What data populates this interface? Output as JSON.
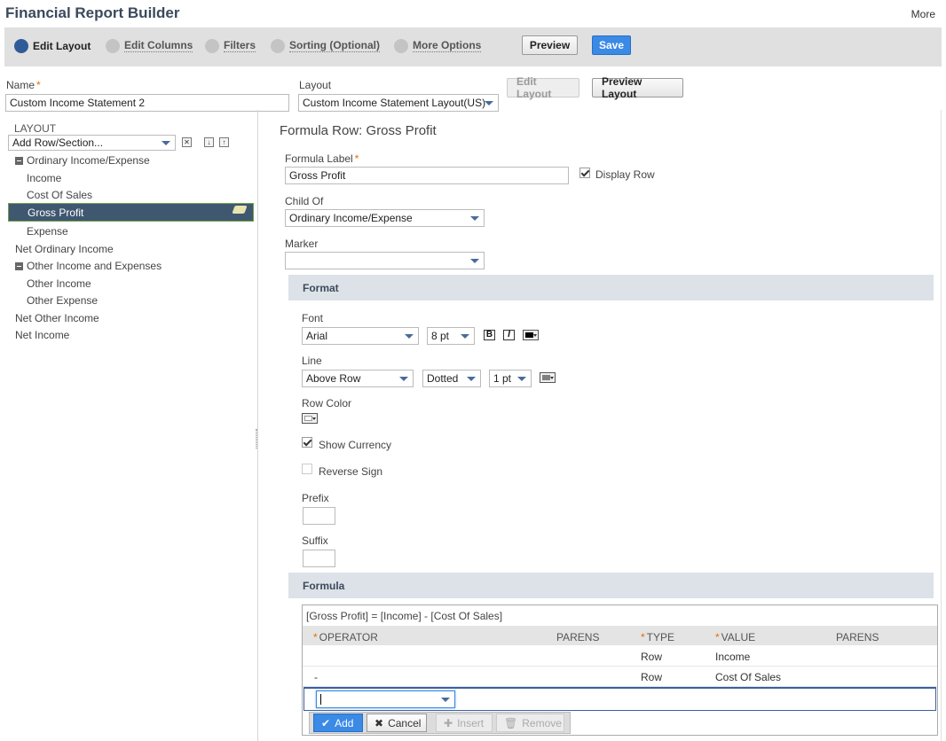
{
  "header": {
    "title": "Financial Report Builder",
    "more_label": "More"
  },
  "steps": [
    {
      "label": "Edit Layout",
      "active": true
    },
    {
      "label": "Edit Columns",
      "active": false
    },
    {
      "label": "Filters",
      "active": false
    },
    {
      "label": "Sorting (Optional)",
      "active": false
    },
    {
      "label": "More Options",
      "active": false
    }
  ],
  "toolbar": {
    "preview_label": "Preview",
    "save_label": "Save"
  },
  "report": {
    "name_label": "Name",
    "name_value": "Custom Income Statement 2",
    "layout_label": "Layout",
    "layout_value": "Custom Income Statement Layout(US)",
    "edit_layout_label": "Edit Layout",
    "preview_layout_label": "Preview Layout"
  },
  "layout_panel": {
    "heading": "LAYOUT",
    "add_select": "Add Row/Section...",
    "items": [
      {
        "label": "Ordinary Income/Expense",
        "level": 0,
        "section": true
      },
      {
        "label": "Income",
        "level": 1
      },
      {
        "label": "Cost Of Sales",
        "level": 1
      },
      {
        "label": "Gross Profit",
        "level": 1,
        "selected": true
      },
      {
        "label": "Expense",
        "level": 1
      },
      {
        "label": "Net Ordinary Income",
        "level": 0
      },
      {
        "label": "Other Income and Expenses",
        "level": 0,
        "section": true
      },
      {
        "label": "Other Income",
        "level": 1
      },
      {
        "label": "Other Expense",
        "level": 1
      },
      {
        "label": "Net Other Income",
        "level": 0
      },
      {
        "label": "Net Income",
        "level": 0
      }
    ]
  },
  "detail": {
    "title": "Formula Row: Gross Profit",
    "formula_label_label": "Formula Label",
    "formula_label_value": "Gross Profit",
    "display_row_label": "Display Row",
    "display_row_checked": true,
    "child_of_label": "Child Of",
    "child_of_value": "Ordinary Income/Expense",
    "marker_label": "Marker",
    "marker_value": ""
  },
  "format": {
    "heading": "Format",
    "font_label": "Font",
    "font_value": "Arial",
    "font_size": "8 pt",
    "bold_glyph": "B",
    "italic_glyph": "I",
    "font_color": "#000000",
    "line_label": "Line",
    "line_position": "Above Row",
    "line_style": "Dotted",
    "line_width": "1 pt",
    "line_color": "#808080",
    "row_color_label": "Row Color",
    "row_color": "#ffffff",
    "show_currency_label": "Show Currency",
    "show_currency_checked": true,
    "reverse_sign_label": "Reverse Sign",
    "reverse_sign_checked": false,
    "prefix_label": "Prefix",
    "prefix_value": "",
    "suffix_label": "Suffix",
    "suffix_value": ""
  },
  "formula": {
    "heading": "Formula",
    "expression": "[Gross Profit] = [Income] - [Cost Of Sales]",
    "columns": {
      "operator": "OPERATOR",
      "parens1": "PARENS",
      "type": "TYPE",
      "value": "VALUE",
      "parens2": "PARENS"
    },
    "rows": [
      {
        "operator": "",
        "type": "Row",
        "value": "Income"
      },
      {
        "operator": "-",
        "type": "Row",
        "value": "Cost Of Sales"
      }
    ],
    "edit_select_value": "",
    "actions": {
      "add": "Add",
      "cancel": "Cancel",
      "insert": "Insert",
      "remove": "Remove"
    }
  }
}
